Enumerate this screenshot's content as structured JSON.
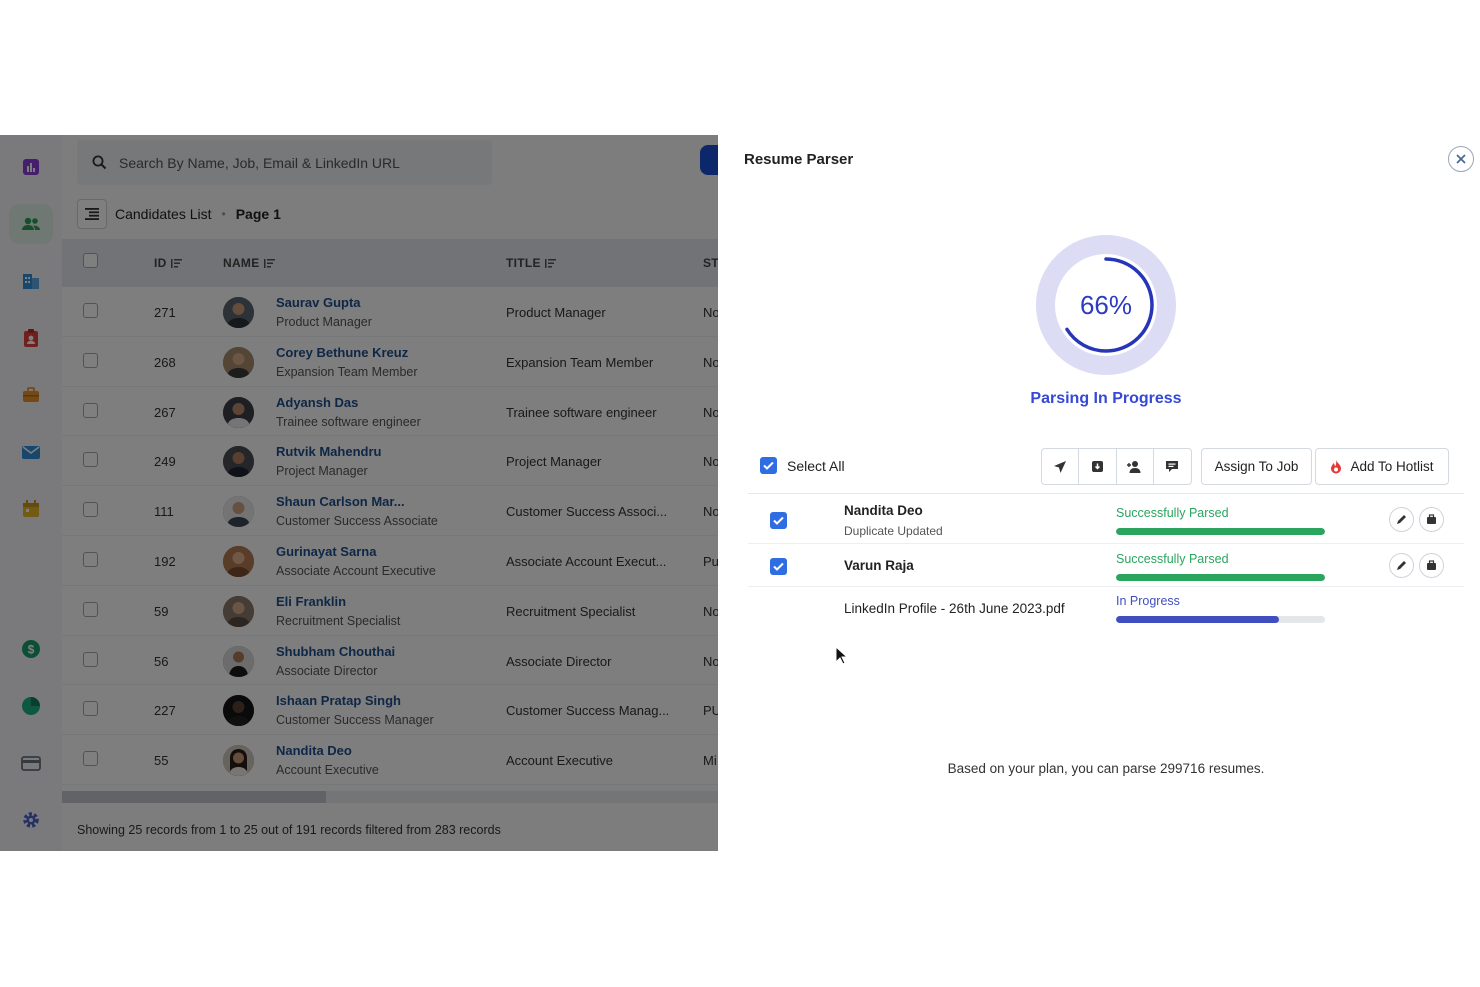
{
  "sidebar": {
    "items": [
      {
        "icon": "bar-chart-icon",
        "color": "#8b3fd8"
      },
      {
        "icon": "people-icon",
        "color": "#2e9e5b",
        "active": true
      },
      {
        "icon": "building-icon",
        "color": "#2f8fd8"
      },
      {
        "icon": "clipboard-icon",
        "color": "#e0413a"
      },
      {
        "icon": "briefcase-icon",
        "color": "#e8922a"
      },
      {
        "icon": "mail-icon",
        "color": "#2f8fd8"
      },
      {
        "icon": "calendar-icon",
        "color": "#e6b628"
      },
      {
        "icon": "dollar-icon",
        "color": "#1a9e6a"
      },
      {
        "icon": "pie-chart-icon",
        "color": "#1fb080"
      },
      {
        "icon": "credit-card-icon",
        "color": "#6b7280"
      },
      {
        "icon": "settings-icon",
        "color": "#4a63c8"
      }
    ]
  },
  "search": {
    "placeholder": "Search By Name, Job, Email & LinkedIn URL"
  },
  "breadcrumb": {
    "list": "Candidates List",
    "page": "Page 1"
  },
  "table": {
    "headers": {
      "id": "ID",
      "name": "NAME",
      "title": "TITLE",
      "status": "ST"
    },
    "rows": [
      {
        "id": "271",
        "name": "Saurav Gupta",
        "subtitle": "Product Manager",
        "title": "Product Manager",
        "status": "No"
      },
      {
        "id": "268",
        "name": "Corey Bethune Kreuz",
        "subtitle": "Expansion Team Member",
        "title": "Expansion Team Member",
        "status": "No"
      },
      {
        "id": "267",
        "name": "Adyansh Das",
        "subtitle": "Trainee software engineer",
        "title": "Trainee software engineer",
        "status": "No"
      },
      {
        "id": "249",
        "name": "Rutvik Mahendru",
        "subtitle": "Project Manager",
        "title": "Project Manager",
        "status": "No"
      },
      {
        "id": "111",
        "name": "Shaun Carlson Mar...",
        "subtitle": "Customer Success Associate",
        "title": "Customer Success Associ...",
        "status": "No"
      },
      {
        "id": "192",
        "name": "Gurinayat Sarna",
        "subtitle": "Associate Account Executive",
        "title": "Associate Account Execut...",
        "status": "Pu"
      },
      {
        "id": "59",
        "name": "Eli Franklin",
        "subtitle": "Recruitment Specialist",
        "title": "Recruitment Specialist",
        "status": "No"
      },
      {
        "id": "56",
        "name": "Shubham Chouthai",
        "subtitle": "Associate Director",
        "title": "Associate Director",
        "status": "No"
      },
      {
        "id": "227",
        "name": "Ishaan Pratap Singh",
        "subtitle": "Customer Success Manager",
        "title": "Customer Success Manag...",
        "status": "PU"
      },
      {
        "id": "55",
        "name": "Nandita Deo",
        "subtitle": "Account Executive",
        "title": "Account Executive",
        "status": "Mi"
      }
    ],
    "footer": "Showing 25 records from 1 to 25 out of 191 records filtered from 283 records"
  },
  "parser": {
    "title": "Resume Parser",
    "progress_pct": 66,
    "progress_label": "66%",
    "status_title": "Parsing In Progress",
    "select_all": "Select All",
    "assign_button": "Assign To Job",
    "hotlist_button": "Add To Hotlist",
    "items": [
      {
        "name": "Nandita Deo",
        "note": "Duplicate Updated",
        "status": "Successfully Parsed",
        "progress": 1.0,
        "checked": true
      },
      {
        "name": "Varun Raja",
        "note": "",
        "status": "Successfully Parsed",
        "progress": 1.0,
        "checked": true
      },
      {
        "name": "LinkedIn Profile - 26th June 2023.pdf",
        "note": "",
        "status": "In Progress",
        "progress": 0.78,
        "checked": false
      }
    ],
    "plan_text": "Based on your plan, you can parse 299716 resumes."
  },
  "colors": {
    "accent_blue": "#3548d6",
    "success_green": "#2aa55e",
    "progress_blue": "#3f4fc0",
    "checkbox_blue": "#2f6ee2",
    "hot_red": "#e53935"
  }
}
